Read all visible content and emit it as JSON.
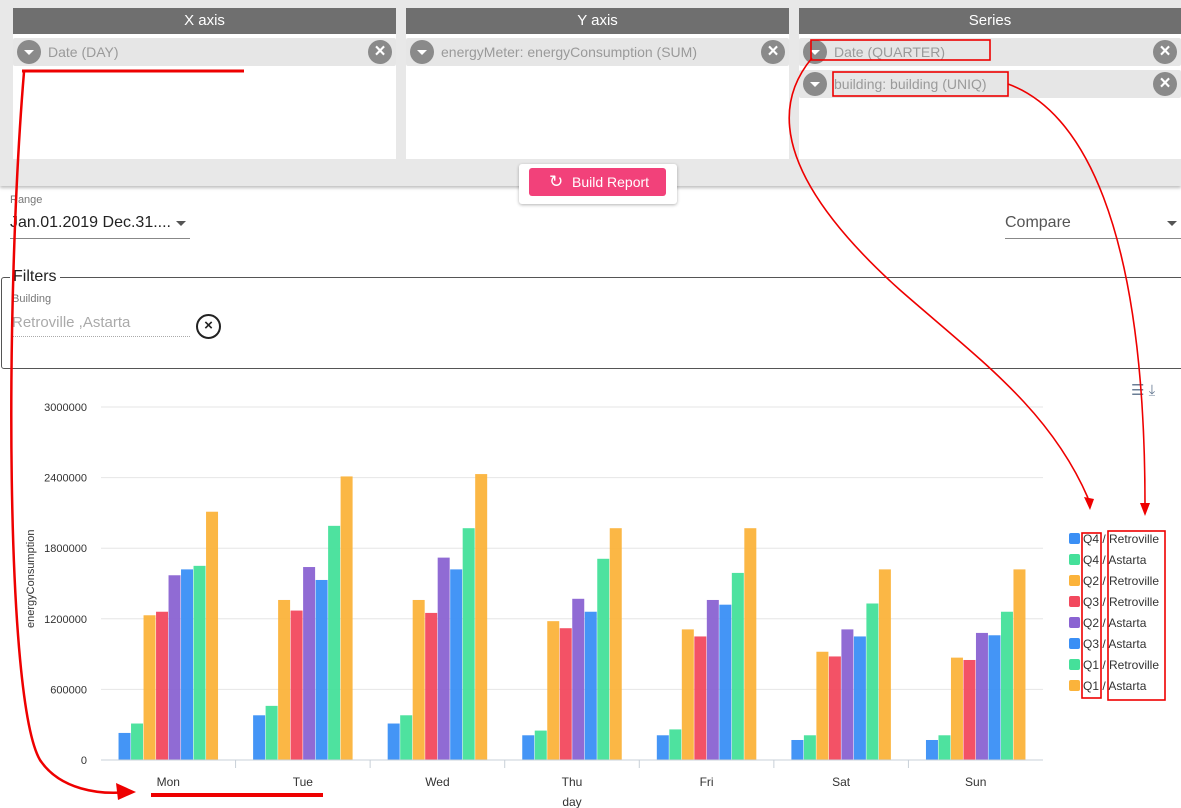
{
  "panels": {
    "x_axis": {
      "title": "X axis",
      "chips": [
        {
          "label": "Date (DAY)"
        }
      ]
    },
    "y_axis": {
      "title": "Y axis",
      "chips": [
        {
          "label": "energyMeter: energyConsumption (SUM)"
        }
      ]
    },
    "series": {
      "title": "Series",
      "chips": [
        {
          "label": "Date (QUARTER)"
        },
        {
          "label": "building: building (UNIQ)"
        }
      ]
    }
  },
  "build_button": {
    "label": "Build Report",
    "icon": "refresh-icon"
  },
  "range": {
    "label": "Range",
    "value": "Jan.01.2019 Dec.31...."
  },
  "compare": {
    "value": "Compare"
  },
  "filters": {
    "title": "Filters",
    "building_label": "Building",
    "building_value": "Retroville  ,Astarta"
  },
  "colors": {
    "accent": "#f2417a",
    "blue": "#3a8ff5",
    "green": "#45e09a",
    "orange": "#fbb33b",
    "red": "#f2495e",
    "purple": "#8a63d2"
  },
  "chart_data": {
    "type": "bar",
    "ylabel": "energyConsumption",
    "xlabel": "day",
    "ylim": [
      0,
      3000000
    ],
    "yticks": [
      "0",
      "600000",
      "1200000",
      "1800000",
      "2400000",
      "3000000"
    ],
    "categories": [
      "Mon",
      "Tue",
      "Wed",
      "Thu",
      "Fri",
      "Sat",
      "Sun"
    ],
    "grid": true,
    "legend_position": "right",
    "series": [
      {
        "name": "Q4 / Retroville",
        "color": "#3a8ff5",
        "values": [
          230000,
          380000,
          310000,
          210000,
          210000,
          170000,
          170000
        ]
      },
      {
        "name": "Q4 / Astarta",
        "color": "#45e09a",
        "values": [
          310000,
          460000,
          380000,
          250000,
          260000,
          210000,
          210000
        ]
      },
      {
        "name": "Q2 / Retroville",
        "color": "#fbb33b",
        "values": [
          1230000,
          1360000,
          1360000,
          1180000,
          1110000,
          920000,
          870000
        ]
      },
      {
        "name": "Q3 / Retroville",
        "color": "#f2495e",
        "values": [
          1260000,
          1270000,
          1250000,
          1120000,
          1050000,
          880000,
          850000
        ]
      },
      {
        "name": "Q2 / Astarta",
        "color": "#8a63d2",
        "values": [
          1570000,
          1640000,
          1720000,
          1370000,
          1360000,
          1110000,
          1080000
        ]
      },
      {
        "name": "Q3 / Astarta",
        "color": "#3a8ff5",
        "values": [
          1620000,
          1530000,
          1620000,
          1260000,
          1320000,
          1050000,
          1060000
        ]
      },
      {
        "name": "Q1 / Retroville",
        "color": "#45e09a",
        "values": [
          1650000,
          1990000,
          1970000,
          1710000,
          1590000,
          1330000,
          1260000
        ]
      },
      {
        "name": "Q1 / Astarta",
        "color": "#fbb33b",
        "values": [
          2110000,
          2410000,
          2430000,
          1970000,
          1970000,
          1620000,
          1620000
        ]
      }
    ]
  }
}
